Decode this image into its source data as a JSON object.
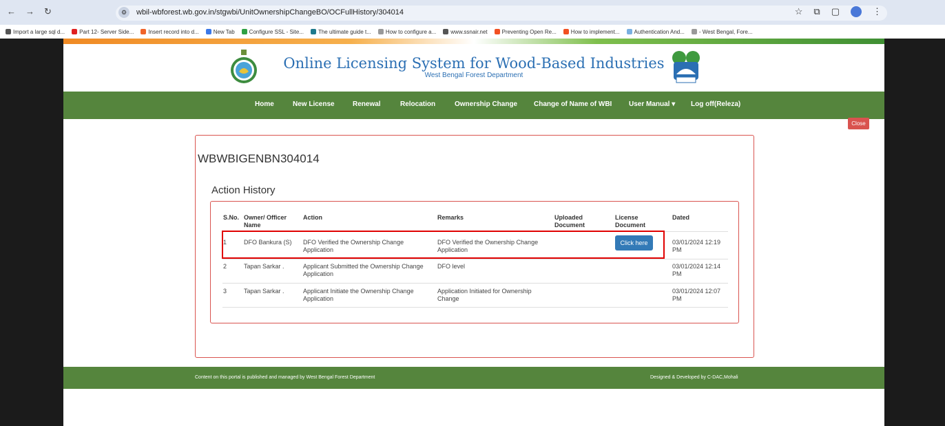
{
  "browser": {
    "url": "wbil-wbforest.wb.gov.in/stgwbi/UnitOwnershipChangeBO/OCFullHistory/304014",
    "bookmarks": [
      {
        "label": "Import a large sql d...",
        "color": "#555555"
      },
      {
        "label": "Part 12- Server Side...",
        "color": "#e02020"
      },
      {
        "label": "Insert record into d...",
        "color": "#f0642a"
      },
      {
        "label": "New Tab",
        "color": "#3b78e7"
      },
      {
        "label": "Configure SSL - Site...",
        "color": "#2ea043"
      },
      {
        "label": "The ultimate guide t...",
        "color": "#1f7a8c"
      },
      {
        "label": "How to configure a...",
        "color": "#999999"
      },
      {
        "label": "www.ssnair.net",
        "color": "#555555"
      },
      {
        "label": "Preventing Open Re...",
        "color": "#f25022"
      },
      {
        "label": "How to implement...",
        "color": "#f25022"
      },
      {
        "label": "Authentication And...",
        "color": "#7ab0e0"
      },
      {
        "label": "- West Bengal, Fore...",
        "color": "#999999"
      }
    ]
  },
  "header": {
    "title": "Online Licensing System for Wood-Based Industries",
    "subtitle": "West Bengal Forest Department"
  },
  "nav": {
    "items": [
      "Home",
      "New License",
      "Renewal",
      "Relocation",
      "Ownership Change",
      "Change of Name of WBI",
      "User Manual ▾",
      "Log off(Releza)"
    ]
  },
  "close_label": "Close",
  "card": {
    "id_title": "WBWBIGENBN304014",
    "section_title": "Action History"
  },
  "table": {
    "headers": [
      "S.No.",
      "Owner/ Officer Name",
      "Action",
      "Remarks",
      "Uploaded Document",
      "License Document",
      "Dated"
    ],
    "rows": [
      {
        "sno": "1",
        "owner": "DFO Bankura (S)",
        "action": "DFO Verified the Ownership Change Application",
        "remarks": "DFO Verified the Ownership Change Application",
        "uploaded": "",
        "license": "Click here",
        "dated": "03/01/2024 12:19 PM"
      },
      {
        "sno": "2",
        "owner": "Tapan Sarkar .",
        "action": "Applicant Submitted the Ownership Change Application",
        "remarks": "DFO level",
        "uploaded": "",
        "license": "",
        "dated": "03/01/2024 12:14 PM"
      },
      {
        "sno": "3",
        "owner": "Tapan Sarkar .",
        "action": "Applicant Initiate the Ownership Change Application",
        "remarks": "Application Initiated for Ownership Change",
        "uploaded": "",
        "license": "",
        "dated": "03/01/2024 12:07 PM"
      }
    ]
  },
  "footer": {
    "left": "Content on this portal is published and managed by West Bengal Forest Department",
    "right": "Designed & Developed by C-DAC,Mohali"
  },
  "colors": {
    "nav_green": "#55853d",
    "title_blue": "#2b6fb3",
    "danger_red": "#d9534f",
    "button_blue": "#337ab7"
  }
}
